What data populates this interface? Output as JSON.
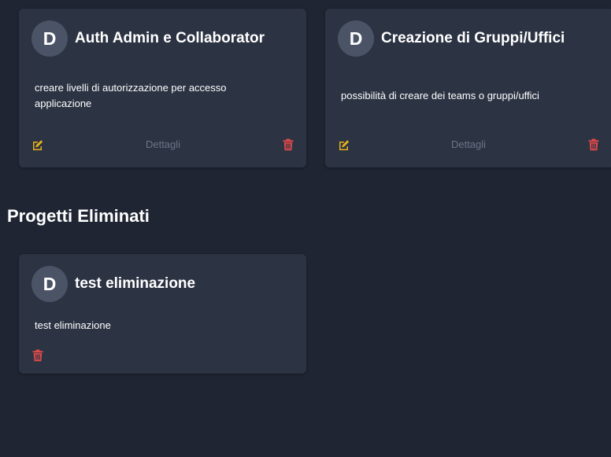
{
  "active_projects": [
    {
      "avatar_letter": "D",
      "title": "Auth Admin e Collaborator",
      "description": "creare livelli di autorizzazione per accesso applicazione",
      "details_label": "Dettagli"
    },
    {
      "avatar_letter": "D",
      "title": "Creazione di Gruppi/Uffici",
      "description": "possibilità di creare dei teams o gruppi/uffici",
      "details_label": "Dettagli"
    }
  ],
  "deleted_section": {
    "heading": "Progetti Eliminati",
    "projects": [
      {
        "avatar_letter": "D",
        "title": "test eliminazione",
        "description": "test eliminazione"
      }
    ]
  },
  "colors": {
    "background": "#1f2533",
    "card": "#2c3343",
    "avatar": "#4a5466",
    "edit_icon": "#e8b21a",
    "delete_icon": "#e04a4a",
    "muted_link": "#6b7487"
  },
  "icons": {
    "edit": "edit-icon",
    "delete": "trash-icon"
  }
}
